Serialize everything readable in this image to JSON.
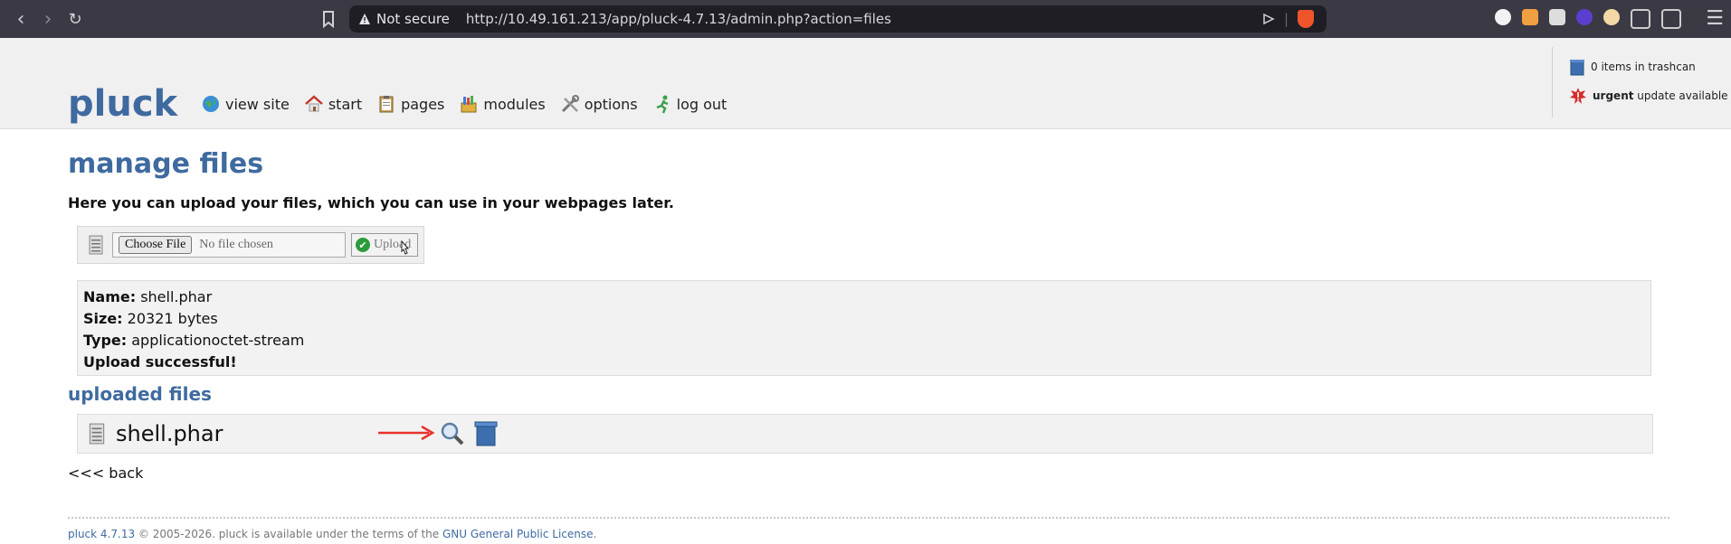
{
  "browser": {
    "security_label": "Not secure",
    "url": "http://10.49.161.213/app/pluck-4.7.13/admin.php?action=files"
  },
  "header": {
    "logo": "pluck",
    "nav": [
      {
        "label": "view site",
        "icon": "globe-icon"
      },
      {
        "label": "start",
        "icon": "home-icon"
      },
      {
        "label": "pages",
        "icon": "clipboard-icon"
      },
      {
        "label": "modules",
        "icon": "modules-icon"
      },
      {
        "label": "options",
        "icon": "tools-icon"
      },
      {
        "label": "log out",
        "icon": "runner-icon"
      }
    ],
    "trash_notice": "0 items in trashcan",
    "update_notice_strong": "urgent",
    "update_notice_rest": "update available"
  },
  "page": {
    "title": "manage files",
    "intro": "Here you can upload your files, which you can use in your webpages later.",
    "choose_file_label": "Choose File",
    "no_file_label": "No file chosen",
    "upload_label": "Upload",
    "result": {
      "name_label": "Name:",
      "name_value": "shell.phar",
      "size_label": "Size:",
      "size_value": "20321 bytes",
      "type_label": "Type:",
      "type_value": "applicationoctet-stream",
      "status": "Upload successful!"
    },
    "uploaded_heading": "uploaded files",
    "files": [
      {
        "name": "shell.phar"
      }
    ],
    "back_link": "<<< back"
  },
  "footer": {
    "version_link": "pluck 4.7.13",
    "text": " © 2005-2026. pluck is available under the terms of the ",
    "license_link": "GNU General Public License",
    "end": "."
  },
  "colors": {
    "brand": "#3f6aa0",
    "chrome": "#3b3a44",
    "annotation_arrow": "#e8322b"
  }
}
